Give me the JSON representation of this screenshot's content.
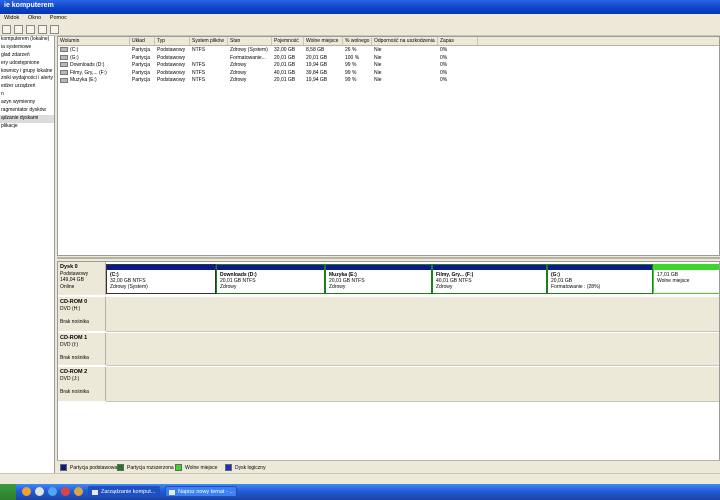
{
  "window": {
    "title": "ie komputerem"
  },
  "menu": [
    "Widok",
    "Okno",
    "Pomoc"
  ],
  "tree": [
    "komputerem (lokalne)",
    "ia systemowe",
    "glad zdarzeń",
    "ery udostępnione",
    "kownicy i grupy lokalne",
    "zniki wydajności i alerty",
    "edżer urządzeń",
    "n",
    "azyn wymienny",
    "ragmentator dysków",
    "ądzanie dyskami",
    "plikacje"
  ],
  "tree_selected_index": 10,
  "volumes": {
    "columns": [
      "Wolumin",
      "Układ",
      "Typ",
      "System plików",
      "Stan",
      "Pojemność",
      "Wolne miejsce",
      "% wolnego",
      "Odporność na uszkodzenia",
      "Zapas"
    ],
    "rows": [
      [
        "(C:)",
        "Partycja",
        "Podstawowy",
        "NTFS",
        "Zdrowy (System)",
        "32,00 GB",
        "8,58 GB",
        "26 %",
        "Nie",
        "0%"
      ],
      [
        "(G:)",
        "Partycja",
        "Podstawowy",
        "",
        "Formatowanie...",
        "20,01 GB",
        "20,01 GB",
        "100 %",
        "Nie",
        "0%"
      ],
      [
        "Downloads (D:)",
        "Partycja",
        "Podstawowy",
        "NTFS",
        "Zdrowy",
        "20,01 GB",
        "19,94 GB",
        "99 %",
        "Nie",
        "0%"
      ],
      [
        "Filmy, Gry,... (F:)",
        "Partycja",
        "Podstawowy",
        "NTFS",
        "Zdrowy",
        "40,01 GB",
        "39,84 GB",
        "99 %",
        "Nie",
        "0%"
      ],
      [
        "Muzyka (E:)",
        "Partycja",
        "Podstawowy",
        "NTFS",
        "Zdrowy",
        "20,01 GB",
        "19,94 GB",
        "99 %",
        "Nie",
        "0%"
      ]
    ]
  },
  "disks": [
    {
      "name": "Dysk 0",
      "type": "Podstawowy",
      "size": "149,04 GB",
      "status": "Online",
      "partitions": [
        {
          "title": "(C:)",
          "size": "32,00 GB NTFS",
          "status": "Zdrowy (System)",
          "color": "#0A1A8C"
        },
        {
          "title": "Downloads (D:)",
          "size": "20,01 GB NTFS",
          "status": "Zdrowy",
          "color": "#0A1A8C"
        },
        {
          "title": "Muzyka (E:)",
          "size": "20,01 GB NTFS",
          "status": "Zdrowy",
          "color": "#0A1A8C"
        },
        {
          "title": "Filmy, Gry... (F:)",
          "size": "40,01 GB NTFS",
          "status": "Zdrowy",
          "color": "#0A1A8C"
        },
        {
          "title": "(G:)",
          "size": "20,01 GB",
          "status": "Formatowanie : (28%)",
          "color": "#0A1A8C"
        },
        {
          "title": "",
          "size": "17,01 GB",
          "status": "Wolne miejsce",
          "color": "#3BD629"
        }
      ]
    },
    {
      "name": "CD-ROM 0",
      "type": "DVD (H:)",
      "media": "Brak nośnika"
    },
    {
      "name": "CD-ROM 1",
      "type": "DVD (I:)",
      "media": "Brak nośnika"
    },
    {
      "name": "CD-ROM 2",
      "type": "DVD (J:)",
      "media": "Brak nośnika"
    }
  ],
  "legend": [
    {
      "label": "Partycja podstawowa",
      "color": "#0A1A8C"
    },
    {
      "label": "Partycja rozszerzona",
      "color": "#1E7B1E"
    },
    {
      "label": "Wolne miejsce",
      "color": "#3BD629"
    },
    {
      "label": "Dysk logiczny",
      "color": "#1D2FC9"
    }
  ],
  "taskbar": [
    {
      "label": "Zarządzanie komput...",
      "active": true
    },
    {
      "label": "Napisz nowy temat - ...",
      "active": false
    }
  ]
}
